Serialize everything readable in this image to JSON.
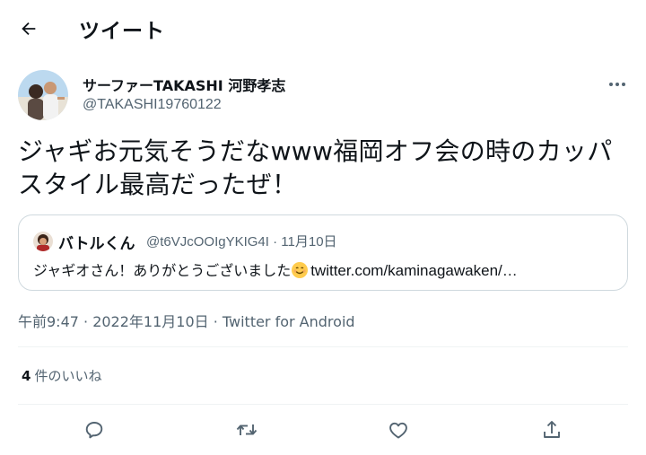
{
  "header": {
    "title": "ツイート"
  },
  "author": {
    "display_name": "サーファーTAKASHI 河野孝志",
    "handle": "@TAKASHI19760122"
  },
  "tweet": {
    "text": "ジャギお元気そうだなwww福岡オフ会の時のカッパスタイル最高だったぜ！"
  },
  "quote": {
    "display_name": "バトルくん",
    "handle": "@t6VJcOOIgYKIG4I",
    "date": "11月10日",
    "text": "ジャギオさん！ありがとうございました",
    "link": "twitter.com/kaminagawaken/…"
  },
  "meta": {
    "timestamp": "午前9:47 · 2022年11月10日 · Twitter for Android"
  },
  "stats": {
    "likes_count": "4",
    "likes_label": "件のいいね"
  },
  "actions": {
    "icons": [
      "reply-icon",
      "retweet-icon",
      "like-icon",
      "share-icon"
    ]
  },
  "colors": {
    "text_primary": "#0f1419",
    "text_secondary": "#536471",
    "border": "#cfd9de",
    "divider": "#eff3f4"
  }
}
